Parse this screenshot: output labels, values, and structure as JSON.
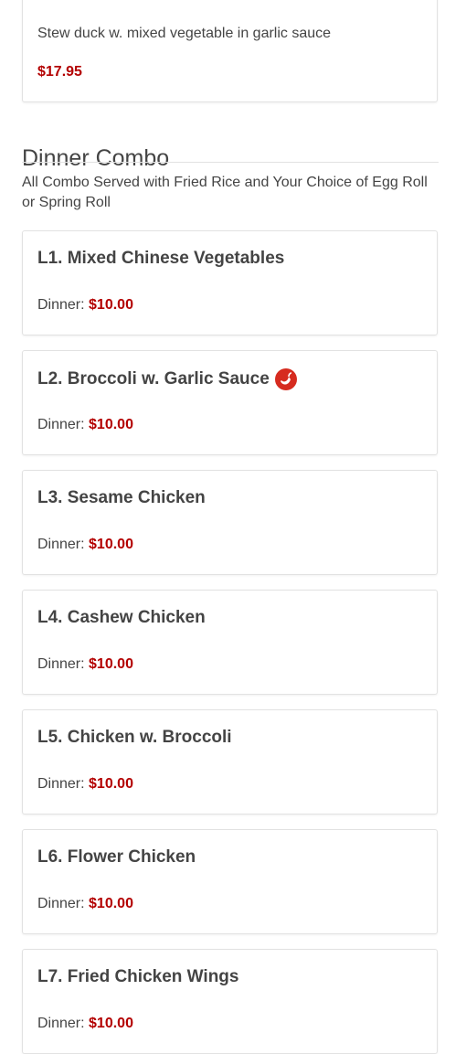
{
  "top_card": {
    "description": "Stew duck w. mixed vegetable in garlic sauce",
    "price": "$17.95"
  },
  "section": {
    "title": "Dinner Combo",
    "note": "All Combo Served with Fried Rice and Your Choice of Egg Roll or Spring Roll"
  },
  "items": [
    {
      "name": "L1. Mixed Chinese Vegetables",
      "price_label": "Dinner:",
      "price": "$10.00",
      "spicy": false
    },
    {
      "name": "L2. Broccoli w. Garlic Sauce",
      "price_label": "Dinner:",
      "price": "$10.00",
      "spicy": true
    },
    {
      "name": "L3. Sesame Chicken",
      "price_label": "Dinner:",
      "price": "$10.00",
      "spicy": false
    },
    {
      "name": "L4. Cashew Chicken",
      "price_label": "Dinner:",
      "price": "$10.00",
      "spicy": false
    },
    {
      "name": "L5. Chicken w. Broccoli",
      "price_label": "Dinner:",
      "price": "$10.00",
      "spicy": false
    },
    {
      "name": "L6. Flower Chicken",
      "price_label": "Dinner:",
      "price": "$10.00",
      "spicy": false
    },
    {
      "name": "L7. Fried Chicken Wings",
      "price_label": "Dinner:",
      "price": "$10.00",
      "spicy": false
    }
  ],
  "colors": {
    "price": "#b30000",
    "spicy_icon": "#d62b1f"
  },
  "icons": {
    "spicy": "spicy-pepper-icon"
  }
}
